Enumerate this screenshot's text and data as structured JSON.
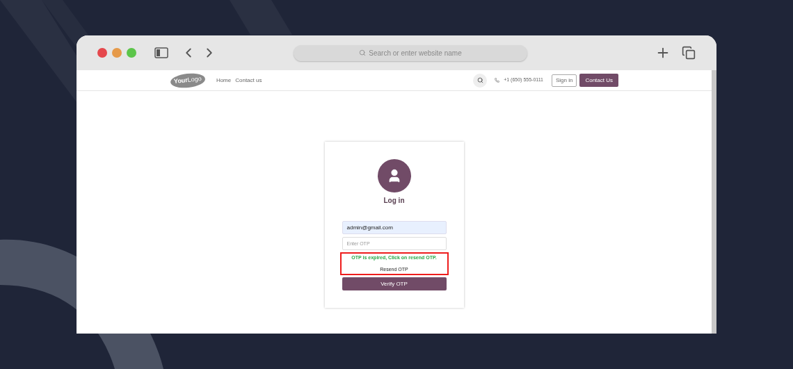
{
  "browser": {
    "address_placeholder": "Search or enter website name"
  },
  "navbar": {
    "logo": "**Your**Logo",
    "links": [
      "Home",
      "Contact us"
    ],
    "phone": "+1 (650) 555-0111",
    "sign_in": "Sign in",
    "contact_button": "Contact Us"
  },
  "login": {
    "title": "Log in",
    "email": "admin@gmail.com",
    "otp_placeholder": "Enter OTP",
    "error": "OTP is expired, Click on resend OTP.",
    "resend": "Resend OTP",
    "verify": "Verify OTP"
  }
}
